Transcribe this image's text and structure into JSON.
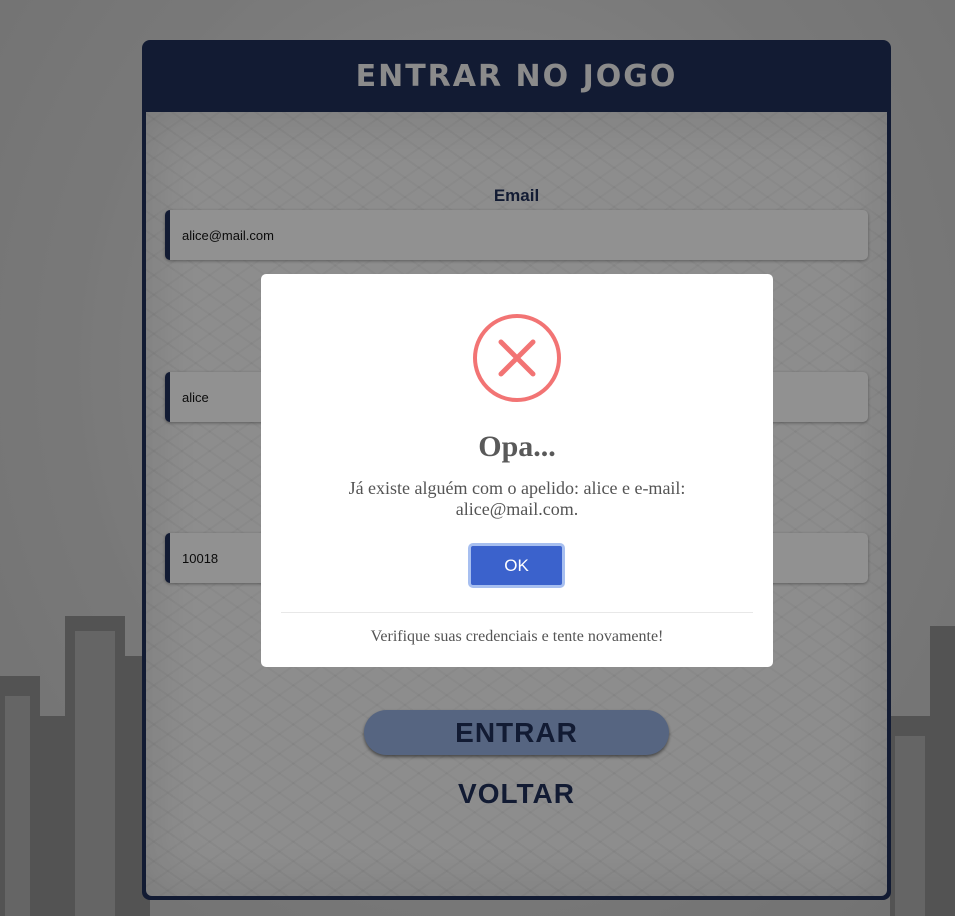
{
  "header": {
    "title": "ENTRAR NO JOGO"
  },
  "form": {
    "email_label": "Email",
    "email_value": "alice@mail.com",
    "nickname_value": "alice",
    "password_value": "10018",
    "submit_label": "ENTRAR",
    "back_label": "VOLTAR"
  },
  "dialog": {
    "icon": "error-x-icon",
    "title": "Opa...",
    "message": "Já existe alguém com o apelido: alice e e-mail: alice@mail.com.",
    "ok_label": "OK",
    "footer": "Verifique suas credenciais e tente novamente!"
  },
  "colors": {
    "navy": "#1f2d55",
    "error_red": "#f27474",
    "ok_blue": "#3b62cc",
    "button_light_blue": "#8fa9d8"
  }
}
